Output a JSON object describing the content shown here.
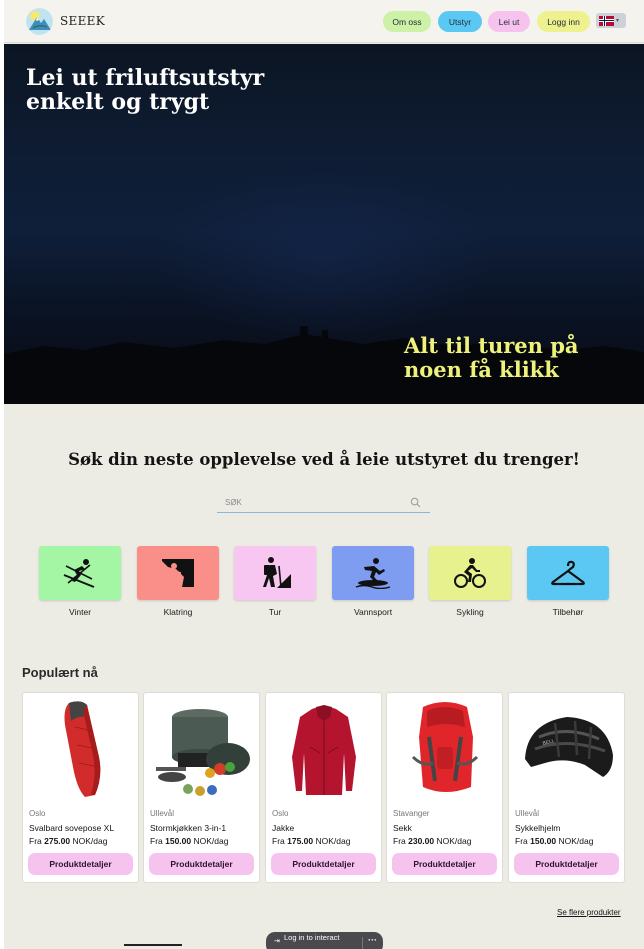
{
  "header": {
    "brand": "SEEEK",
    "nav": [
      {
        "label": "Om oss",
        "color": "#cdf1a6"
      },
      {
        "label": "Utstyr",
        "color": "#5bc8f3"
      },
      {
        "label": "Lei ut",
        "color": "#f6c3ee"
      },
      {
        "label": "Logg inn",
        "color": "#eef28e"
      }
    ],
    "language_icon": "norway-flag-icon"
  },
  "hero": {
    "title_line1": "Lei ut friluftsutstyr",
    "title_line2": "enkelt og trygt",
    "tagline_line1": "Alt til turen på",
    "tagline_line2": "noen få klikk"
  },
  "search": {
    "heading": "Søk din neste opplevelse ved å leie utstyret du trenger!",
    "placeholder": "SØK",
    "icon": "search-icon"
  },
  "categories": [
    {
      "label": "Vinter",
      "color": "#a4f5a4",
      "icon": "skier-icon"
    },
    {
      "label": "Klatring",
      "color": "#fa8f8a",
      "icon": "climber-icon"
    },
    {
      "label": "Tur",
      "color": "#f7c6f1",
      "icon": "hiker-icon"
    },
    {
      "label": "Vannsport",
      "color": "#7f9df0",
      "icon": "surfer-icon"
    },
    {
      "label": "Sykling",
      "color": "#e7f28e",
      "icon": "cyclist-icon"
    },
    {
      "label": "Tilbehør",
      "color": "#5bc8f3",
      "icon": "hanger-icon"
    }
  ],
  "popular": {
    "title": "Populært nå",
    "items": [
      {
        "location": "Oslo",
        "name": "Svalbard sovepose XL",
        "price_prefix": "Fra",
        "price": "275.00",
        "unit": "NOK/dag",
        "button": "Produktdetaljer",
        "image": "sleeping-bag-image"
      },
      {
        "location": "Ullevål",
        "name": "Stormkjøkken 3-in-1",
        "price_prefix": "Fra",
        "price": "150.00",
        "unit": "NOK/dag",
        "button": "Produktdetaljer",
        "image": "camping-stove-image"
      },
      {
        "location": "Oslo",
        "name": "Jakke",
        "price_prefix": "Fra",
        "price": "175.00",
        "unit": "NOK/dag",
        "button": "Produktdetaljer",
        "image": "jacket-image"
      },
      {
        "location": "Stavanger",
        "name": "Sekk",
        "price_prefix": "Fra",
        "price": "230.00",
        "unit": "NOK/dag",
        "button": "Produktdetaljer",
        "image": "backpack-image"
      },
      {
        "location": "Ullevål",
        "name": "Sykkelhjelm",
        "price_prefix": "Fra",
        "price": "150.00",
        "unit": "NOK/dag",
        "button": "Produktdetaljer",
        "image": "helmet-image"
      }
    ],
    "see_more": "Se flere produkter"
  },
  "overlay": {
    "login_text": "Log in to interact",
    "more": "···"
  }
}
